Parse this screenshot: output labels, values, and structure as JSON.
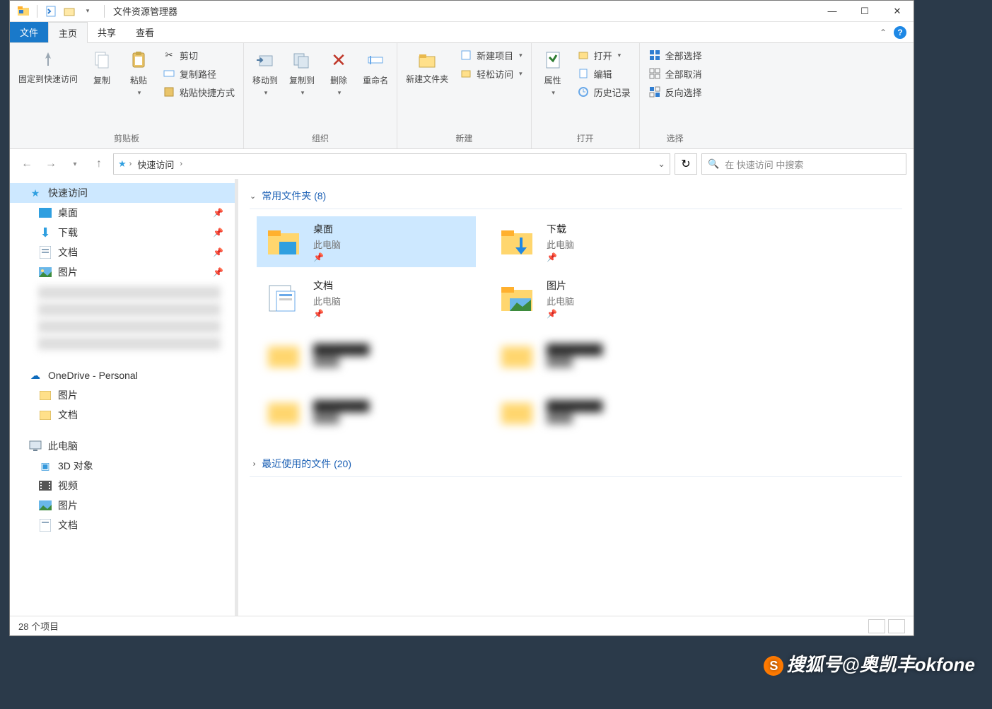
{
  "titlebar": {
    "title": "文件资源管理器"
  },
  "tabs": {
    "file": "文件",
    "home": "主页",
    "share": "共享",
    "view": "查看"
  },
  "ribbon": {
    "g1": {
      "label": "剪贴板",
      "pin": "固定到快速访问",
      "copy": "复制",
      "paste": "粘贴",
      "cut": "剪切",
      "copypath": "复制路径",
      "pasteshortcut": "粘贴快捷方式"
    },
    "g2": {
      "label": "组织",
      "moveto": "移动到",
      "copyto": "复制到",
      "delete": "删除",
      "rename": "重命名"
    },
    "g3": {
      "label": "新建",
      "newfolder": "新建文件夹",
      "newitem": "新建项目",
      "easyaccess": "轻松访问"
    },
    "g4": {
      "label": "打开",
      "properties": "属性",
      "open": "打开",
      "edit": "编辑",
      "history": "历史记录"
    },
    "g5": {
      "label": "选择",
      "selectall": "全部选择",
      "selectnone": "全部取消",
      "invert": "反向选择"
    }
  },
  "nav": {
    "crumb": "快速访问"
  },
  "search": {
    "placeholder": "在 快速访问 中搜索"
  },
  "sidebar": {
    "quick": "快速访问",
    "desktop": "桌面",
    "downloads": "下载",
    "documents": "文档",
    "pictures": "图片",
    "onedrive": "OneDrive - Personal",
    "od_pictures": "图片",
    "od_documents": "文档",
    "thispc": "此电脑",
    "3d": "3D 对象",
    "videos": "视频",
    "pc_pictures": "图片",
    "pc_documents": "文档"
  },
  "content": {
    "freq_header": "常用文件夹 (8)",
    "recent_header": "最近使用的文件 (20)",
    "thispc": "此电脑",
    "items": {
      "desktop": "桌面",
      "downloads": "下载",
      "documents": "文档",
      "pictures": "图片"
    }
  },
  "status": {
    "count": "28 个项目"
  },
  "watermark": {
    "text": "搜狐号@奥凯丰okfone"
  }
}
